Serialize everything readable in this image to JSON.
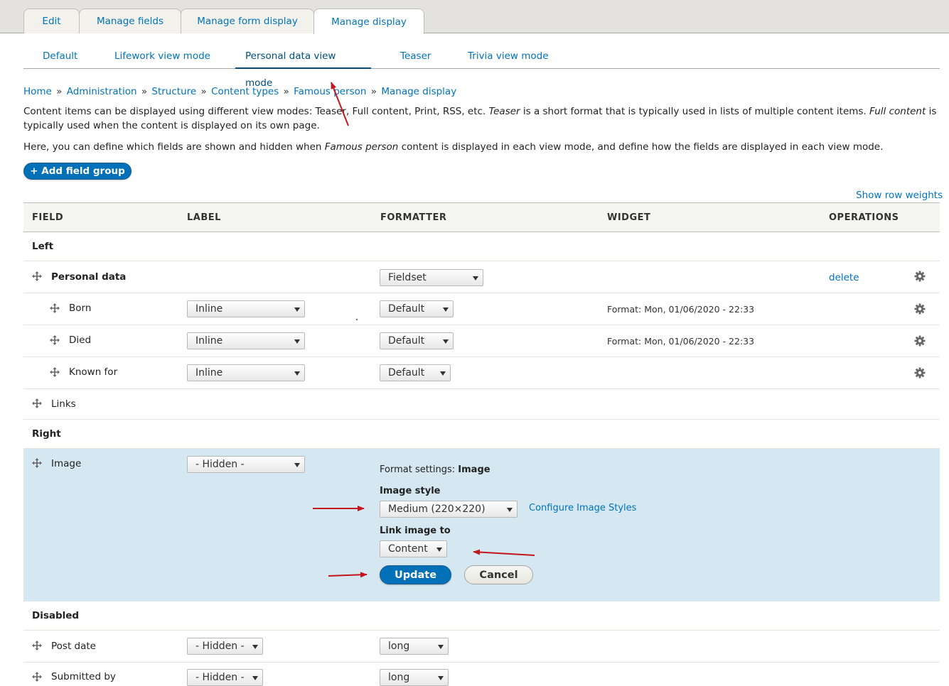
{
  "primary_tabs": [
    {
      "label": "Edit",
      "active": false
    },
    {
      "label": "Manage fields",
      "active": false
    },
    {
      "label": "Manage form display",
      "active": false
    },
    {
      "label": "Manage display",
      "active": true
    }
  ],
  "secondary_tabs": [
    {
      "label": "Default",
      "active": false
    },
    {
      "label": "Lifework view mode",
      "active": false
    },
    {
      "label": "Personal data view mode",
      "active": true
    },
    {
      "label": "Teaser",
      "active": false
    },
    {
      "label": "Trivia view mode",
      "active": false
    }
  ],
  "breadcrumb": {
    "sep": "»",
    "items": [
      "Home",
      "Administration",
      "Structure",
      "Content types",
      "Famous person",
      "Manage display"
    ]
  },
  "description": {
    "p1_a": "Content items can be displayed using different view modes: Teaser, Full content, Print, RSS, etc. ",
    "p1_em1": "Teaser",
    "p1_b": " is a short format that is typically used in lists of multiple content items. ",
    "p1_em2": "Full content",
    "p1_c": " is typically used when the content is displayed on its own page.",
    "p2_a": "Here, you can define which fields are shown and hidden when ",
    "p2_em": "Famous person",
    "p2_b": " content is displayed in each view mode, and define how the fields are displayed in each view mode."
  },
  "add_field_group": "+ Add field group",
  "show_row_weights": "Show row weights",
  "table": {
    "headers": {
      "field": "FIELD",
      "label": "LABEL",
      "formatter": "FORMATTER",
      "widget": "WIDGET",
      "operations": "OPERATIONS"
    },
    "regions": {
      "left": "Left",
      "right": "Right",
      "disabled": "Disabled"
    },
    "personal_data": {
      "name": "Personal data",
      "formatter": "Fieldset",
      "delete": "delete"
    },
    "born": {
      "name": "Born",
      "label": "Inline",
      "formatter": "Default",
      "widget": "Format: Mon, 01/06/2020 - 22:33"
    },
    "died": {
      "name": "Died",
      "label": "Inline",
      "formatter": "Default",
      "widget": "Format: Mon, 01/06/2020 - 22:33"
    },
    "known_for": {
      "name": "Known for",
      "label": "Inline",
      "formatter": "Default"
    },
    "links": {
      "name": "Links"
    },
    "image": {
      "name": "Image",
      "label": "- Hidden -",
      "format_settings_prefix": "Format settings: ",
      "format_settings_name": "Image",
      "image_style_label": "Image style",
      "image_style_value": "Medium (220×220)",
      "configure_link": "Configure Image Styles",
      "link_image_label": "Link image to",
      "link_image_value": "Content",
      "update": "Update",
      "cancel": "Cancel"
    },
    "post_date": {
      "name": "Post date",
      "label": "- Hidden -",
      "formatter": "long"
    },
    "submitted_by": {
      "name": "Submitted by",
      "label": "- Hidden -",
      "formatter": "long"
    }
  },
  "colors": {
    "link": "#0074bd",
    "primary_button": "#0071b8",
    "editing_row": "#d5e7f0",
    "annotation_arrow": "#c4161c"
  }
}
